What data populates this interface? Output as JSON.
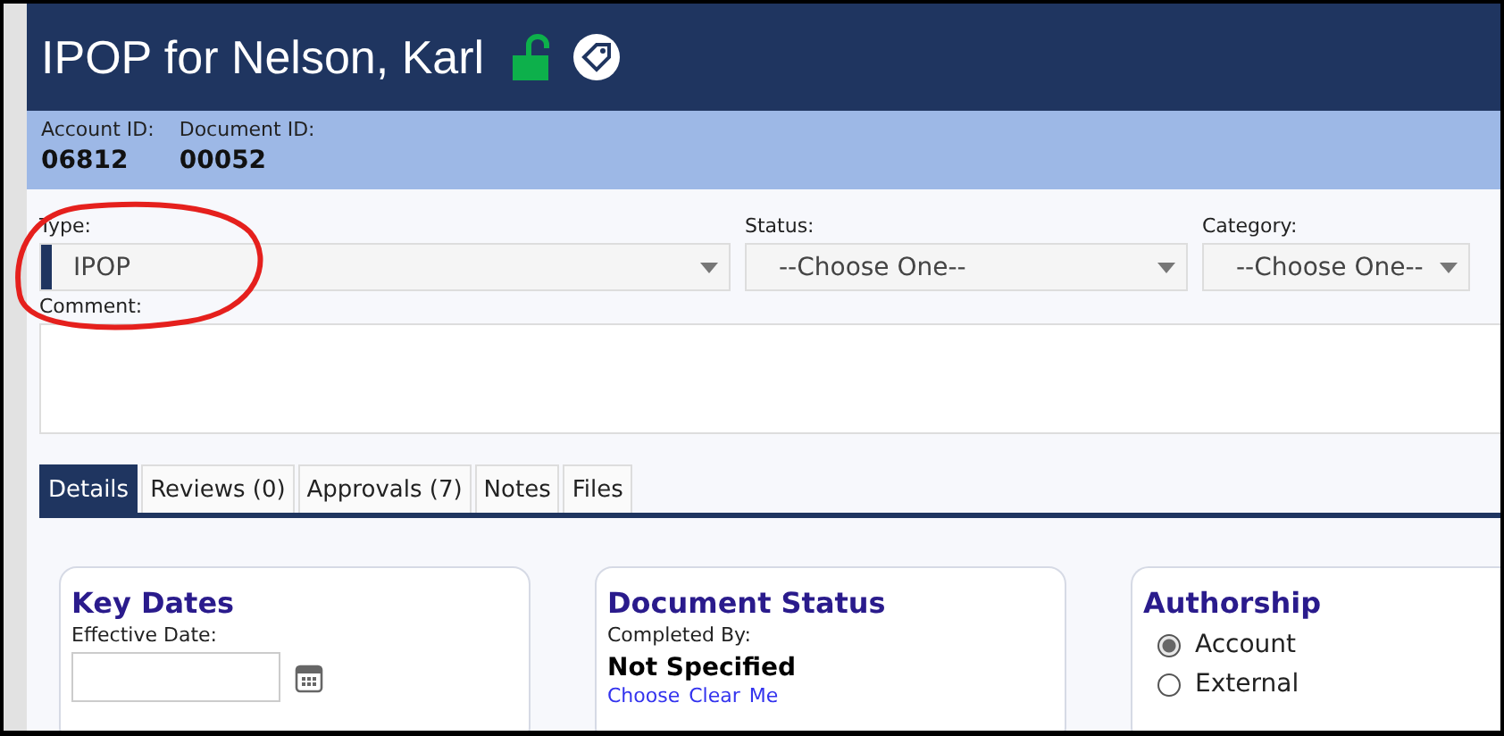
{
  "header": {
    "title": "IPOP for Nelson, Karl",
    "locked": false
  },
  "ids": [
    {
      "label": "Account ID:",
      "value": "06812"
    },
    {
      "label": "Document ID:",
      "value": "00052"
    }
  ],
  "fields": [
    {
      "label": "Type:",
      "value": "IPOP",
      "selected": true
    },
    {
      "label": "Status:",
      "value": "--Choose One--",
      "selected": false
    },
    {
      "label": "Category:",
      "value": "--Choose One--",
      "selected": false
    }
  ],
  "comment": {
    "label": "Comment:"
  },
  "tabs": [
    {
      "label": "Details",
      "selected": true
    },
    {
      "label": "Reviews (0)",
      "selected": false
    },
    {
      "label": "Approvals (7)",
      "selected": false
    },
    {
      "label": "Notes",
      "selected": false
    },
    {
      "label": "Files",
      "selected": false
    }
  ],
  "key_dates": {
    "title": "Key Dates",
    "label": "Effective Date:"
  },
  "document_status": {
    "title": "Document Status",
    "label": "Completed By:",
    "value": "Not Specified",
    "links": [
      "Choose",
      "Clear",
      "Me"
    ]
  },
  "authorship": {
    "title": "Authorship",
    "options": [
      {
        "label": "Account",
        "selected": true
      },
      {
        "label": "External",
        "selected": false
      }
    ]
  }
}
